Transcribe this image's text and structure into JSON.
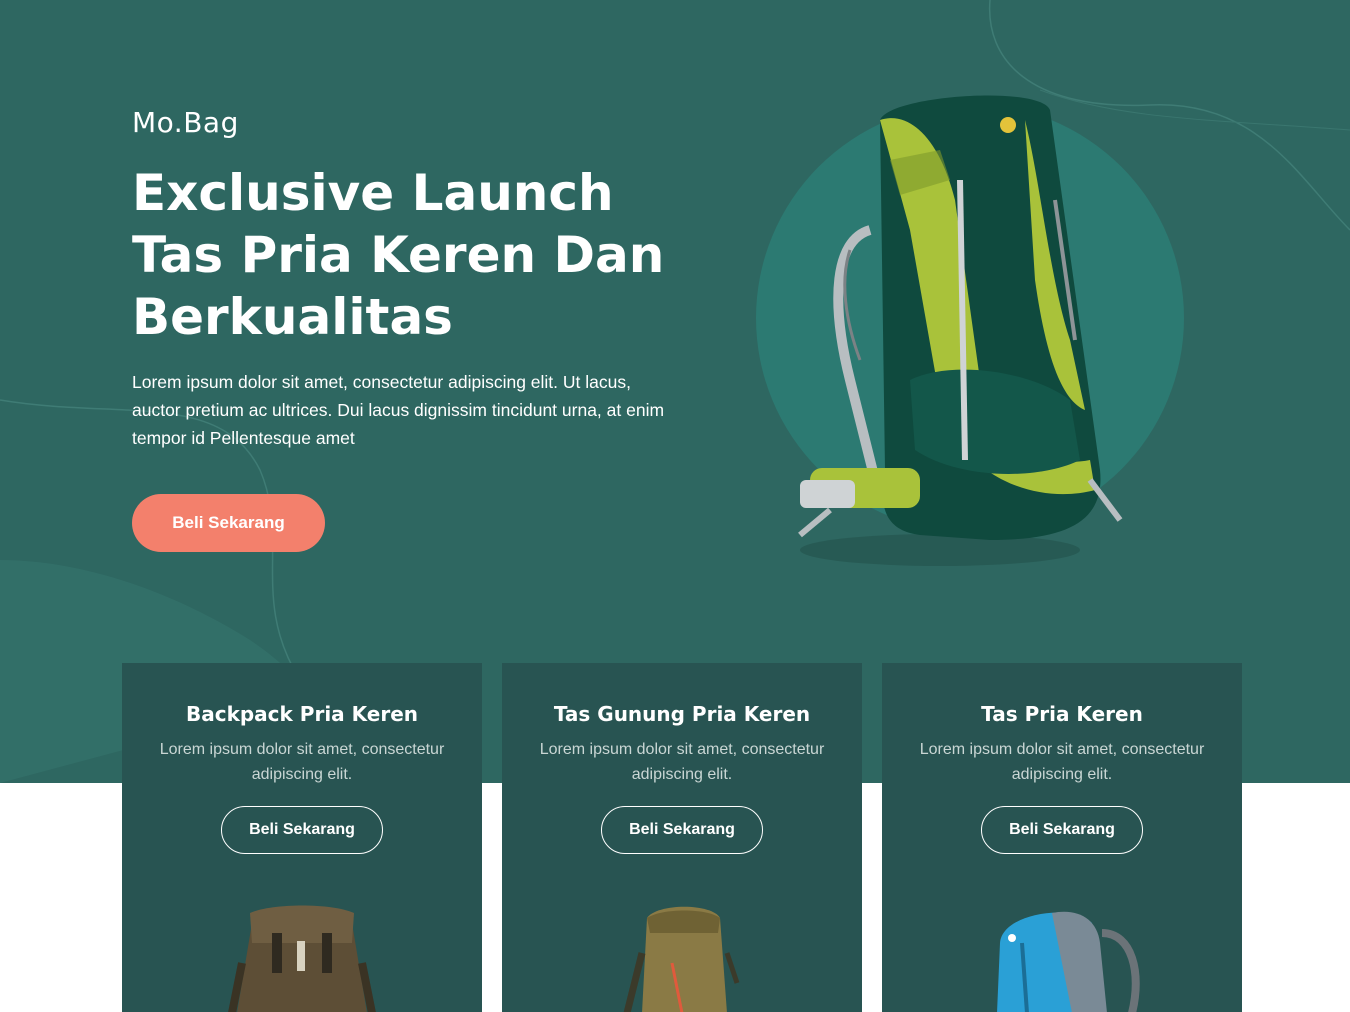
{
  "brand": {
    "name": "Mo.Bag"
  },
  "hero": {
    "headline_lines": [
      "Exclusive Launch",
      "Tas Pria Keren Dan",
      "Berkualitas"
    ],
    "lead": "Lorem ipsum dolor sit amet, consectetur adipiscing elit. Ut lacus, auctor pretium ac ultrices. Dui lacus dignissim tincidunt urna, at enim tempor id Pellentesque amet",
    "cta_label": "Beli Sekarang",
    "image_icon": "hiking-backpack-image"
  },
  "products": [
    {
      "title": "Backpack Pria Keren",
      "description": "Lorem ipsum dolor sit amet, consectetur adipiscing elit.",
      "button_label": "Beli Sekarang",
      "image_icon": "brown-backpack-image"
    },
    {
      "title": "Tas Gunung Pria Keren",
      "description": "Lorem ipsum dolor sit amet, consectetur adipiscing elit.",
      "button_label": "Beli Sekarang",
      "image_icon": "olive-hiking-backpack-image"
    },
    {
      "title": "Tas Pria Keren",
      "description": "Lorem ipsum dolor sit amet, consectetur adipiscing elit.",
      "button_label": "Beli Sekarang",
      "image_icon": "blue-backpack-image"
    }
  ],
  "colors": {
    "hero_bg": "#2e6761",
    "card_bg": "#285452",
    "accent": "#f3806c",
    "circle": "#2c7a72",
    "page_bg": "#ffffff"
  }
}
